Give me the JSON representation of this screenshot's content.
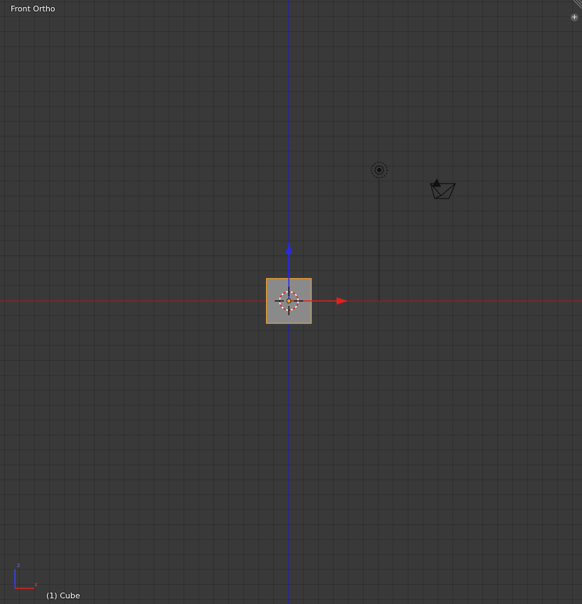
{
  "viewport": {
    "view_name": "Front Ortho",
    "active_object": "(1) Cube"
  },
  "axes": {
    "mini_z_label": "z",
    "mini_x_label": "x"
  },
  "icons": {
    "corner": "split-corner-icon",
    "plus": "plus-icon",
    "lamp": "lamp-icon",
    "camera": "camera-icon",
    "origin": "3d-cursor-icon"
  },
  "colors": {
    "background": "#393939",
    "x_axis": "#c02020",
    "z_axis": "#2020d0",
    "selection": "#f0a030",
    "object_fill": "#8c8c8c"
  }
}
